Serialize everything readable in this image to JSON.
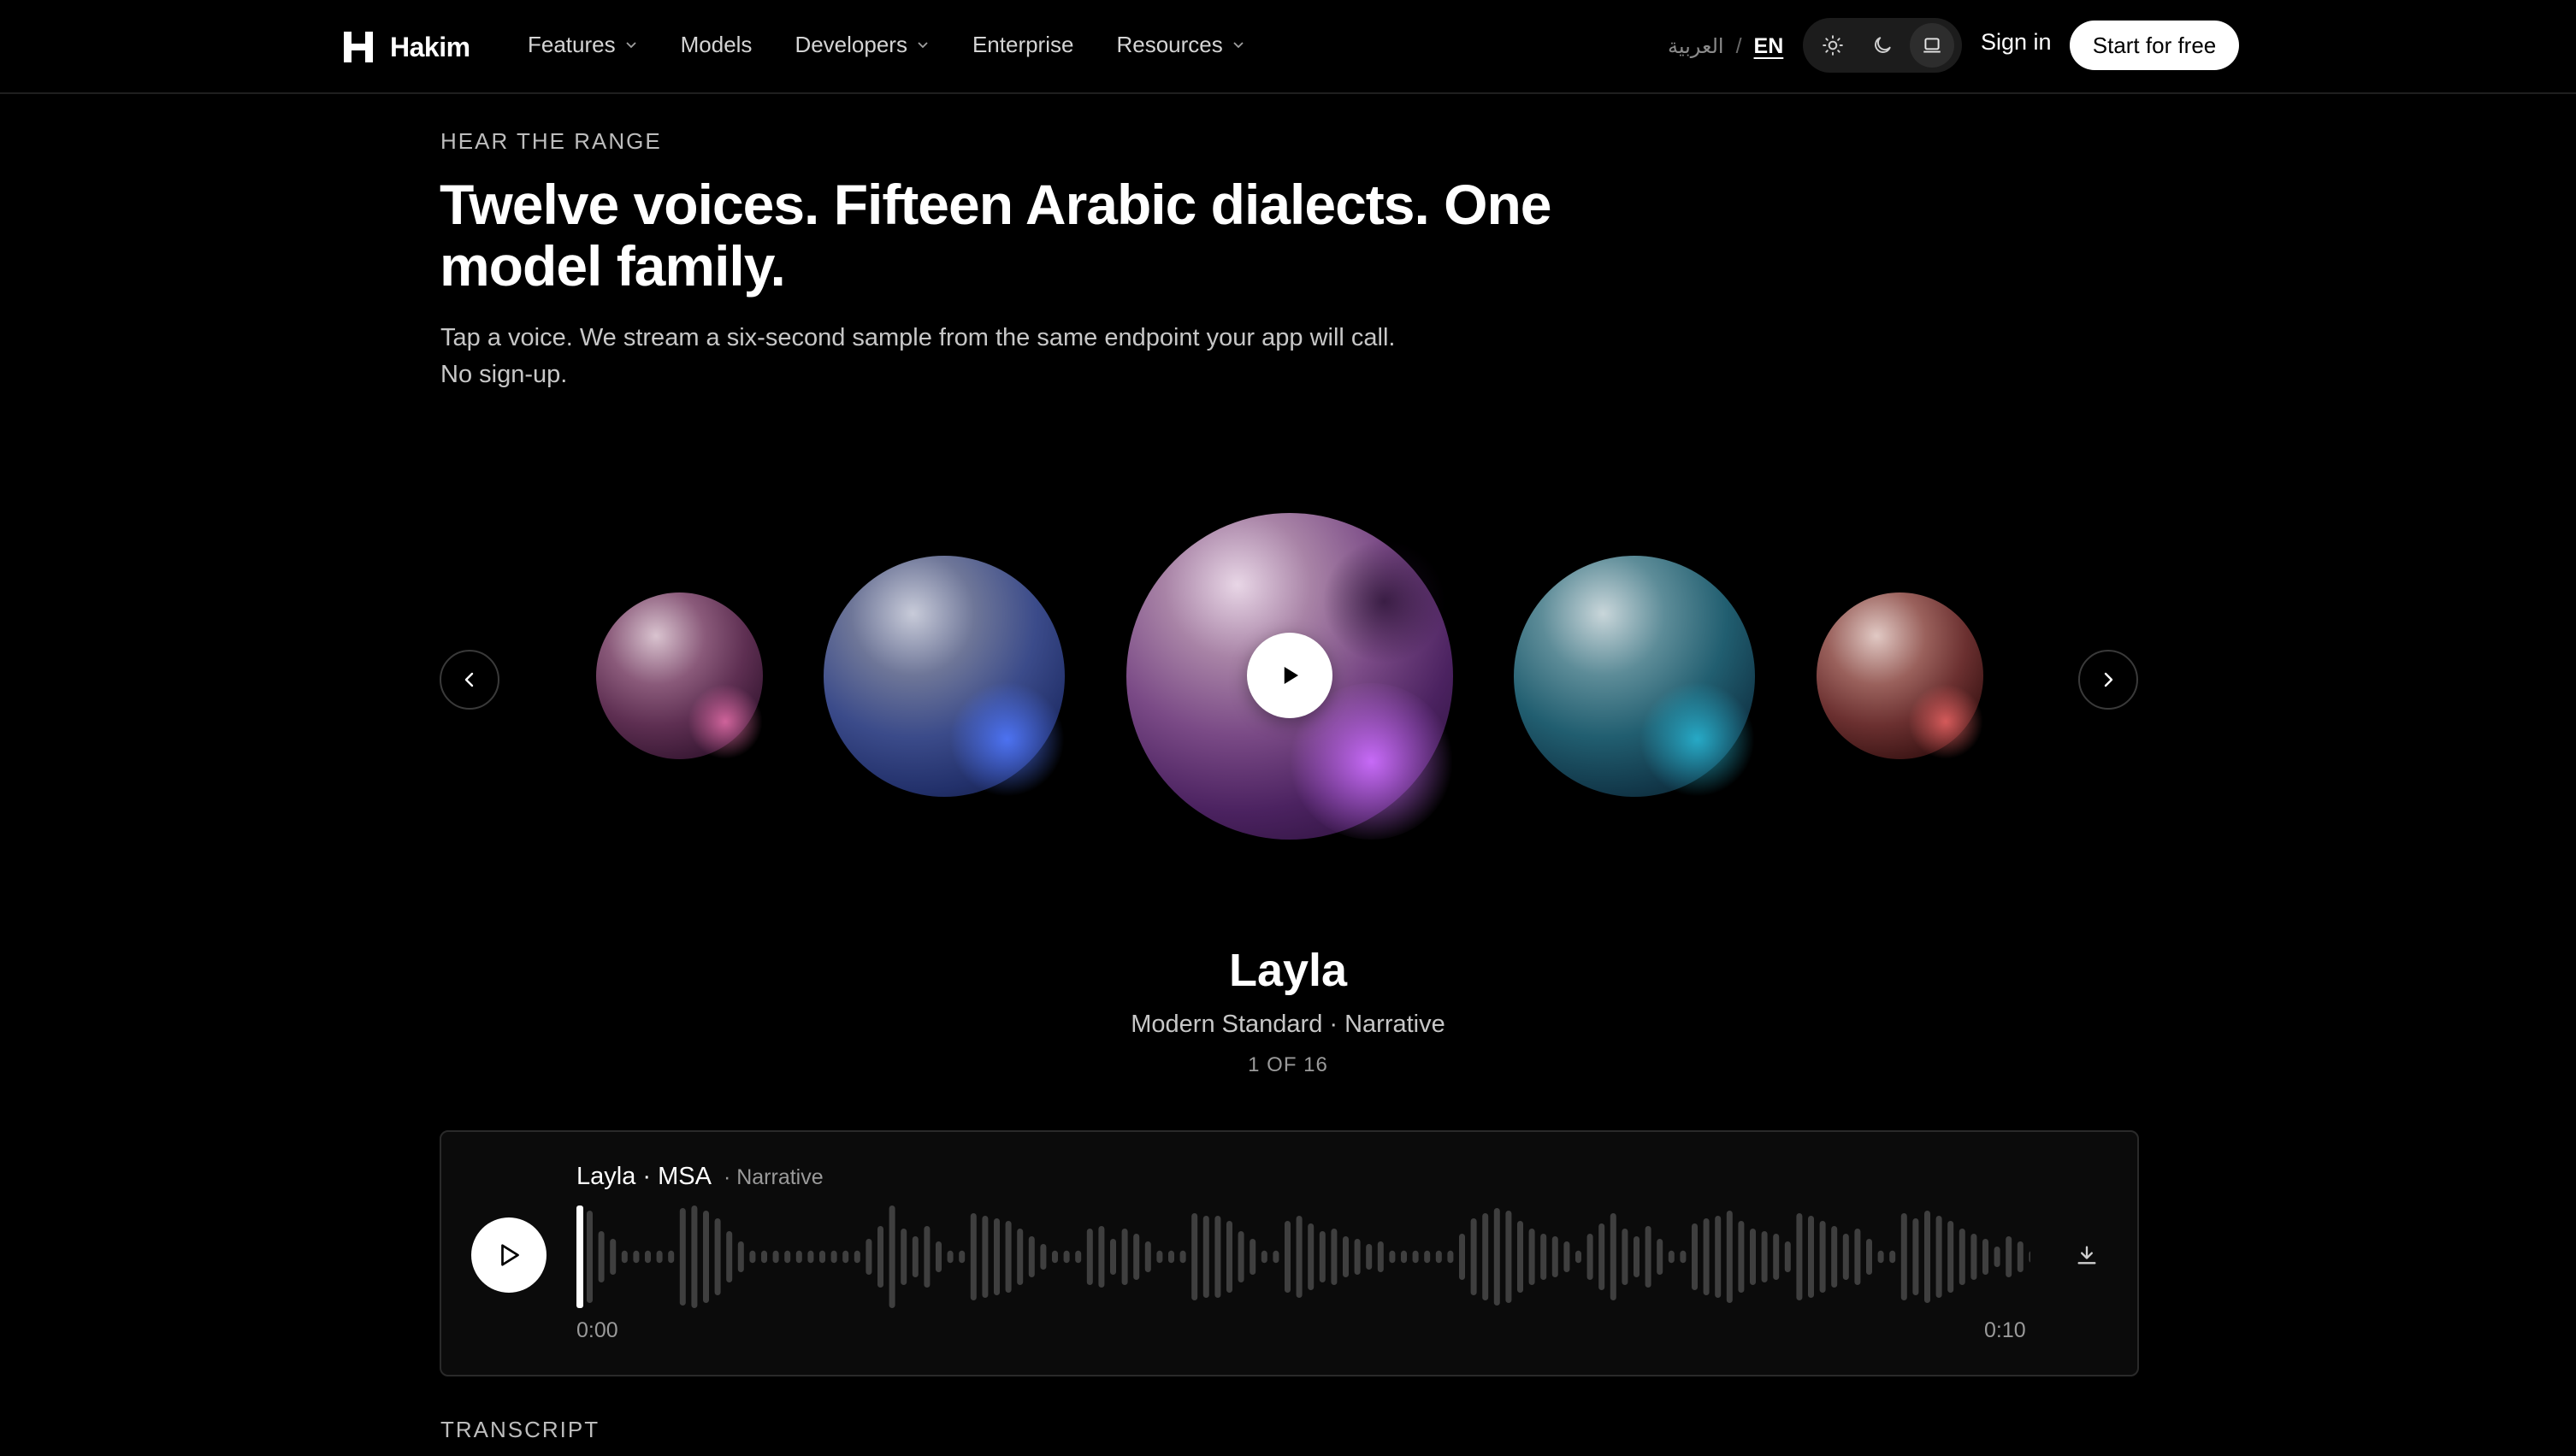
{
  "brand": {
    "name": "Hakim"
  },
  "nav": {
    "items": [
      {
        "label": "Features",
        "has_dropdown": true
      },
      {
        "label": "Models",
        "has_dropdown": false
      },
      {
        "label": "Developers",
        "has_dropdown": true
      },
      {
        "label": "Enterprise",
        "has_dropdown": false
      },
      {
        "label": "Resources",
        "has_dropdown": true
      }
    ],
    "language": {
      "arabic": "العربية",
      "separator": "/",
      "english": "EN",
      "active": "EN"
    },
    "theme": {
      "options": [
        "sun-icon",
        "moon-icon",
        "laptop-icon"
      ],
      "active": "laptop-icon"
    },
    "sign_in": "Sign in",
    "cta": "Start for free"
  },
  "hero": {
    "eyebrow": "HEAR THE RANGE",
    "headline": "Twelve voices. Fifteen Arabic dialects. One model family.",
    "sub_line1": "Tap a voice. We stream a six-second sample from the same endpoint your app will call.",
    "sub_line2": "No sign-up."
  },
  "carousel": {
    "orbs": [
      {
        "color": "#e06aa8"
      },
      {
        "color": "#4f78ff"
      },
      {
        "color": "#cd6eff",
        "selected": true
      },
      {
        "color": "#28b4d2"
      },
      {
        "color": "#eb6464"
      }
    ],
    "selected": {
      "name": "Layla",
      "meta": "Modern Standard · Narrative",
      "count": "1 OF 16"
    }
  },
  "player": {
    "title": "Layla · MSA",
    "style": "· Narrative",
    "time_start": "0:00",
    "time_end": "0:10",
    "progress": 0
  },
  "transcript": {
    "label": "TRANSCRIPT"
  },
  "colors": {
    "background": "#000000",
    "text": "#ffffff",
    "muted": "#9a9a9a",
    "waveform": "#3f3f3f",
    "playhead": "#ffffff"
  }
}
